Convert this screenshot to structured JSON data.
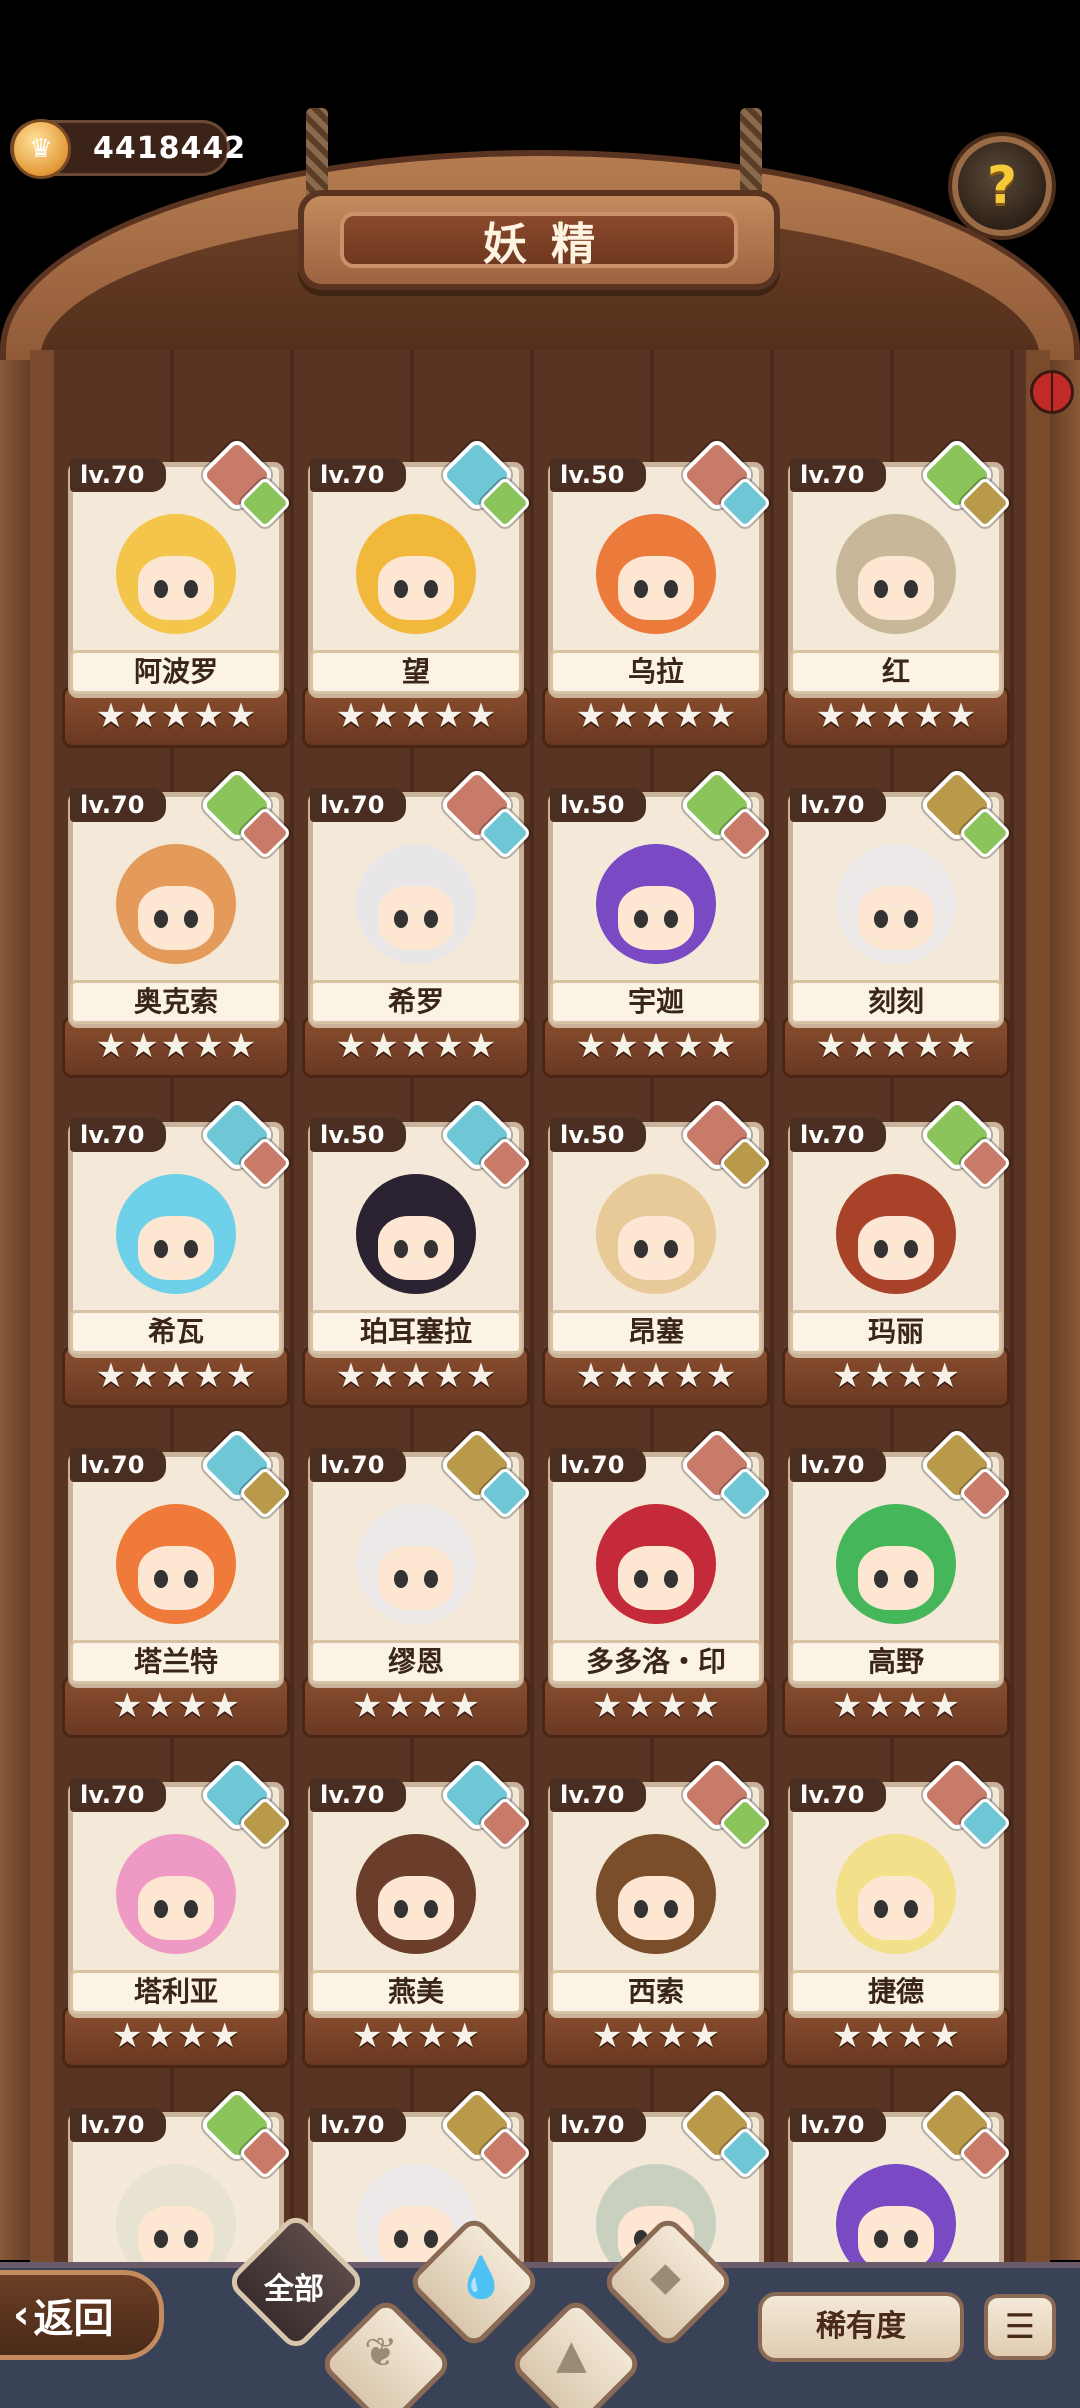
{
  "header": {
    "coins": "4418442",
    "title": "妖精",
    "help_icon": "question-sprout-icon"
  },
  "colors": {
    "water": "#6fc7d6",
    "nature": "#8bc45a",
    "earth": "#b89a4a",
    "fire": "#c97b6a",
    "gold_star": "#f6f2e8"
  },
  "fairies": [
    {
      "level": "lv.70",
      "name": "阿波罗",
      "stars": 5,
      "element": "fire",
      "sub": "nature",
      "hair": "#f3c54a"
    },
    {
      "level": "lv.70",
      "name": "望",
      "stars": 5,
      "element": "water",
      "sub": "nature",
      "hair": "#f2b83c"
    },
    {
      "level": "lv.50",
      "name": "乌拉",
      "stars": 5,
      "element": "fire",
      "sub": "water",
      "hair": "#ec7a3a"
    },
    {
      "level": "lv.70",
      "name": "红",
      "stars": 5,
      "element": "nature",
      "sub": "earth",
      "hair": "#c9b79a"
    },
    {
      "level": "lv.70",
      "name": "奥克索",
      "stars": 5,
      "element": "nature",
      "sub": "fire",
      "hair": "#e39a5a"
    },
    {
      "level": "lv.70",
      "name": "希罗",
      "stars": 5,
      "element": "fire",
      "sub": "water",
      "hair": "#e8e6e6"
    },
    {
      "level": "lv.50",
      "name": "宇迦",
      "stars": 5,
      "element": "nature",
      "sub": "fire",
      "hair": "#7a4ac4"
    },
    {
      "level": "lv.70",
      "name": "刻刻",
      "stars": 5,
      "element": "earth",
      "sub": "nature",
      "hair": "#eeeaea"
    },
    {
      "level": "lv.70",
      "name": "希瓦",
      "stars": 5,
      "element": "water",
      "sub": "fire",
      "hair": "#6fd0ea"
    },
    {
      "level": "lv.50",
      "name": "珀耳塞拉",
      "stars": 5,
      "element": "water",
      "sub": "fire",
      "hair": "#2a2230"
    },
    {
      "level": "lv.50",
      "name": "昂塞",
      "stars": 5,
      "element": "fire",
      "sub": "earth",
      "hair": "#e8c998"
    },
    {
      "level": "lv.70",
      "name": "玛丽",
      "stars": 4,
      "element": "nature",
      "sub": "fire",
      "hair": "#a8432a"
    },
    {
      "level": "lv.70",
      "name": "塔兰特",
      "stars": 4,
      "element": "water",
      "sub": "earth",
      "hair": "#ef7a3a"
    },
    {
      "level": "lv.70",
      "name": "缪恩",
      "stars": 4,
      "element": "earth",
      "sub": "water",
      "hair": "#eeeaea"
    },
    {
      "level": "lv.70",
      "name": "多多洛・印",
      "stars": 4,
      "element": "fire",
      "sub": "water",
      "hair": "#c42a3a"
    },
    {
      "level": "lv.70",
      "name": "高野",
      "stars": 4,
      "element": "earth",
      "sub": "fire",
      "hair": "#46b65a"
    },
    {
      "level": "lv.70",
      "name": "塔利亚",
      "stars": 4,
      "element": "water",
      "sub": "earth",
      "hair": "#ef9ac4"
    },
    {
      "level": "lv.70",
      "name": "燕美",
      "stars": 4,
      "element": "water",
      "sub": "fire",
      "hair": "#6a3e2a"
    },
    {
      "level": "lv.70",
      "name": "西索",
      "stars": 4,
      "element": "fire",
      "sub": "nature",
      "hair": "#7a4e2a"
    },
    {
      "level": "lv.70",
      "name": "捷德",
      "stars": 4,
      "element": "fire",
      "sub": "water",
      "hair": "#f3e08a"
    },
    {
      "level": "lv.70",
      "name": "",
      "stars": 0,
      "element": "nature",
      "sub": "fire",
      "hair": "#e8e2d0"
    },
    {
      "level": "lv.70",
      "name": "",
      "stars": 0,
      "element": "earth",
      "sub": "fire",
      "hair": "#eeeaea"
    },
    {
      "level": "lv.70",
      "name": "",
      "stars": 0,
      "element": "earth",
      "sub": "water",
      "hair": "#c9d0c0"
    },
    {
      "level": "lv.70",
      "name": "",
      "stars": 0,
      "element": "earth",
      "sub": "fire",
      "hair": "#7a4ac4"
    }
  ],
  "bottom": {
    "back_label": "返回",
    "filter_all_label": "全部",
    "rarity_label": "稀有度",
    "sort_icon": "sort-list-icon"
  }
}
